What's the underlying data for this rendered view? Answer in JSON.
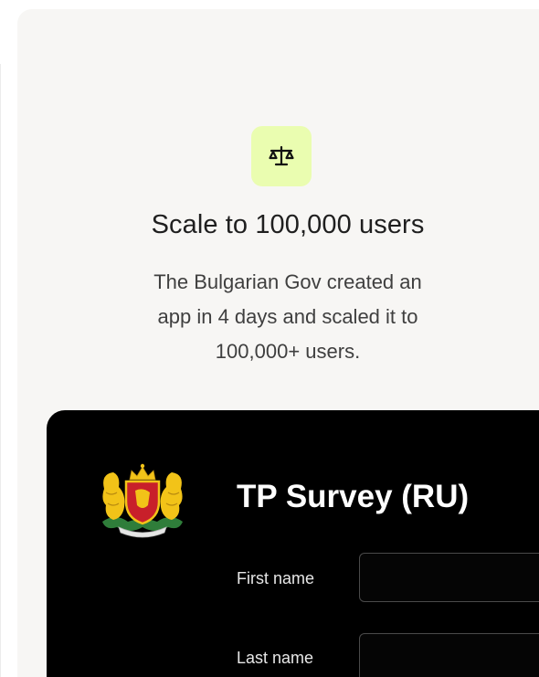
{
  "feature": {
    "icon": "scale-balance-icon",
    "title": "Scale to 100,000 users",
    "description": "The Bulgarian Gov created an\napp in 4 days and scaled it to\n100,000+ users."
  },
  "preview": {
    "crest_icon": "bulgarian-coat-of-arms-icon",
    "survey_title": "TP Survey (RU)",
    "fields": [
      {
        "label": "First name",
        "value": ""
      },
      {
        "label": "Last name",
        "value": ""
      }
    ]
  },
  "colors": {
    "card_background": "#f7f6f4",
    "icon_badge": "#eafdb0",
    "preview_background": "#000000"
  }
}
